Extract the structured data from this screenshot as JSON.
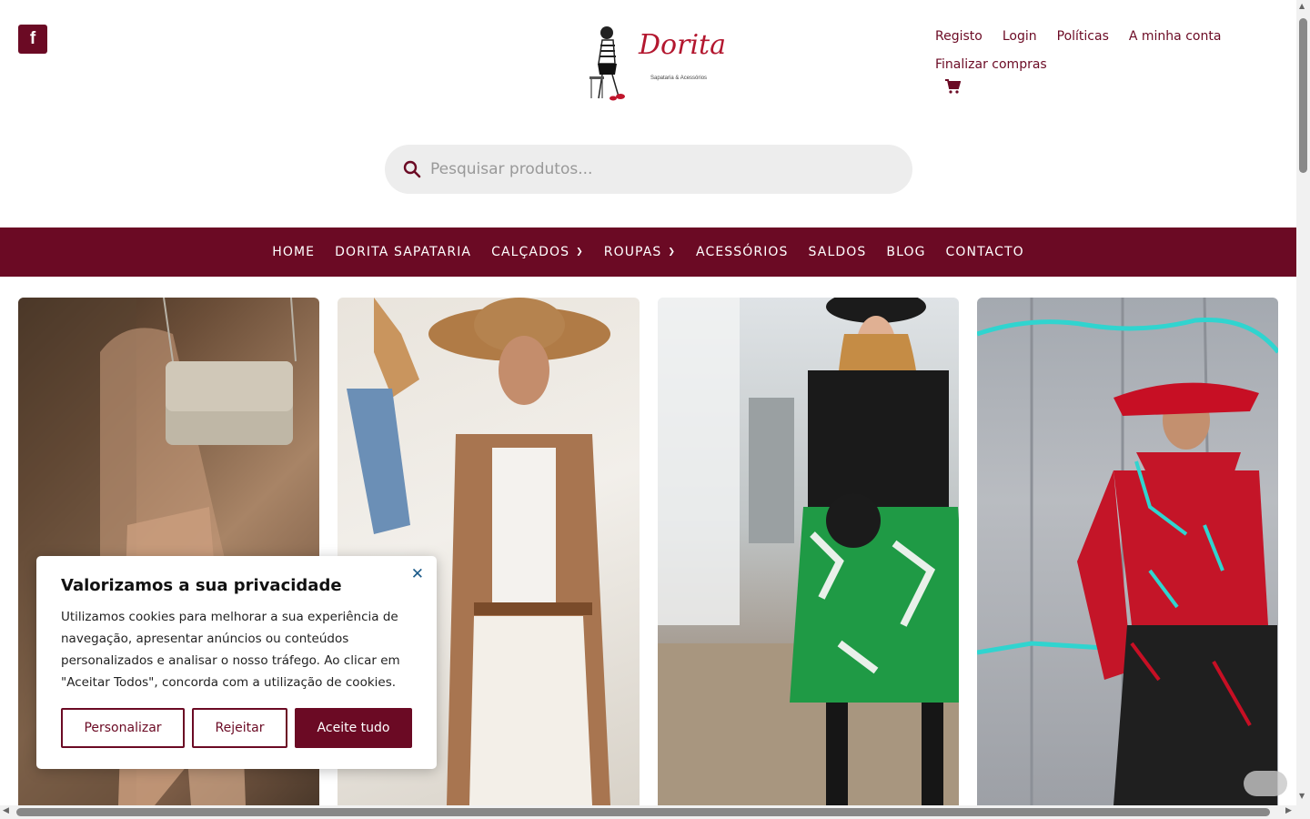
{
  "social": {
    "facebook_glyph": "f"
  },
  "logo": {
    "brand_script": "Dorita",
    "tagline": "Sapataria & Acessórios"
  },
  "top_links": {
    "items": [
      "Registo",
      "Login",
      "Políticas",
      "A minha conta"
    ],
    "checkout": "Finalizar compras"
  },
  "search": {
    "placeholder": "Pesquisar produtos..."
  },
  "nav": {
    "items": [
      {
        "label": "HOME",
        "dropdown": false
      },
      {
        "label": "DORITA SAPATARIA",
        "dropdown": false
      },
      {
        "label": "CALÇADOS",
        "dropdown": true
      },
      {
        "label": "ROUPAS",
        "dropdown": true
      },
      {
        "label": "ACESSÓRIOS",
        "dropdown": false
      },
      {
        "label": "SALDOS",
        "dropdown": false
      },
      {
        "label": "BLOG",
        "dropdown": false
      },
      {
        "label": "CONTACTO",
        "dropdown": false
      }
    ]
  },
  "cookie": {
    "title": "Valorizamos a sua privacidade",
    "body": "Utilizamos cookies para melhorar a sua experiência de navegação, apresentar anúncios ou conteúdos personalizados e analisar o nosso tráfego. Ao clicar em \"Aceitar Todos\", concorda com a utilização de cookies.",
    "close_glyph": "✕",
    "buttons": {
      "customize": "Personalizar",
      "reject": "Rejeitar",
      "accept": "Aceite tudo"
    }
  },
  "colors": {
    "brand": "#6b0a24",
    "accent_logo": "#b3172f"
  }
}
